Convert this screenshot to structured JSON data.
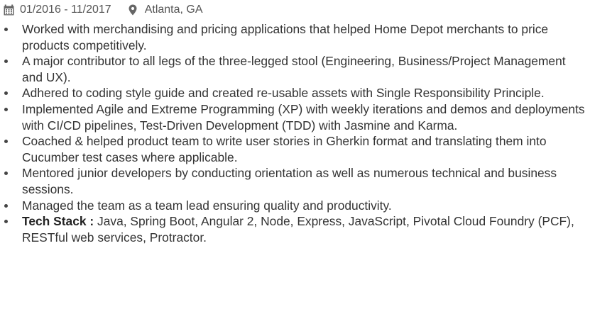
{
  "job": {
    "date_range": "01/2016 - 11/2017",
    "date_icon": "calendar-icon",
    "location": "Atlanta, GA",
    "location_icon": "map-marker-icon"
  },
  "bullets": [
    "Worked with merchandising and pricing applications that helped Home Depot merchants to price products competitively.",
    "A major contributor to all legs of the three-legged stool (Engineering, Business/Project Management and UX).",
    "Adhered to coding style guide and created re-usable assets with Single Responsibility Principle.",
    "Implemented Agile and Extreme Programming (XP) with weekly iterations and demos and deployments with CI/CD pipelines, Test-Driven Development (TDD) with Jasmine and Karma.",
    "Coached & helped product team to write user stories in Gherkin format and translating them into Cucumber test cases where applicable.",
    "Mentored junior developers by conducting orientation as well as numerous technical and business sessions.",
    "Managed the team as a team lead ensuring quality and productivity."
  ],
  "tech_stack": {
    "label": "Tech Stack :",
    "value": " Java, Spring Boot, Angular 2, Node, Express, JavaScript, Pivotal Cloud Foundry (PCF), RESTful web services, Protractor."
  },
  "colors": {
    "text": "#333333",
    "meta_text": "#555555",
    "bullet": "#444444",
    "icon": "#666666"
  }
}
